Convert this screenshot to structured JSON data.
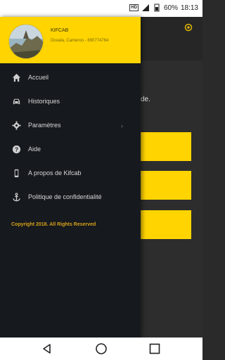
{
  "status_bar": {
    "hd": "HD",
    "battery": "60%",
    "time": "18:13"
  },
  "background": {
    "partial_text": "de."
  },
  "drawer": {
    "header": {
      "name": "KIFCAB",
      "subtitle": "Douala, Cameroo - 690774764"
    },
    "menu": [
      {
        "label": "Accueil",
        "icon": "home-icon"
      },
      {
        "label": "Historiques",
        "icon": "car-icon"
      },
      {
        "label": "Paramètres",
        "icon": "gear-icon",
        "has_chevron": true
      },
      {
        "label": "Aide",
        "icon": "help-icon"
      },
      {
        "label": "A propos de Kifcab",
        "icon": "phone-icon"
      },
      {
        "label": "Politique de confidentialité",
        "icon": "anchor-icon"
      }
    ],
    "copyright": "Copyright 2018. All Rights Reserved"
  },
  "colors": {
    "accent": "#ffd400",
    "drawer_bg": "#16191e",
    "copyright": "#d8a21a"
  }
}
